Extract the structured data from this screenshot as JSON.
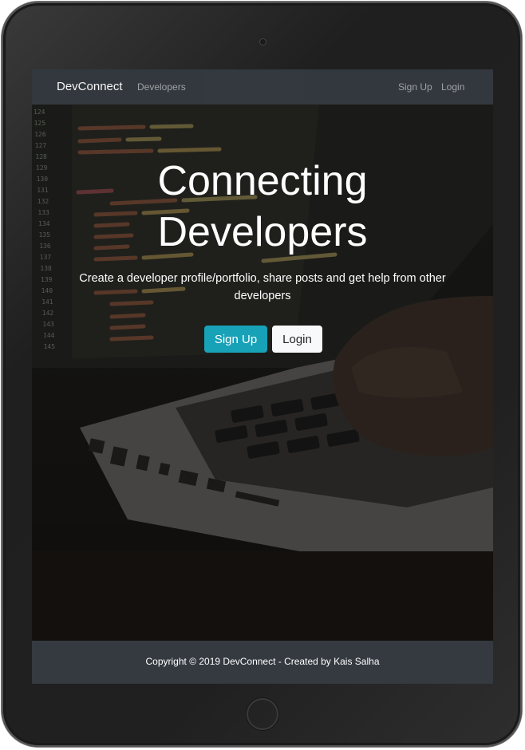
{
  "navbar": {
    "brand": "DevConnect",
    "developers_link": "Developers",
    "signup_link": "Sign Up",
    "login_link": "Login"
  },
  "hero": {
    "title_line1": "Connecting",
    "title_line2": "Developers",
    "lead": "Create a developer profile/portfolio, share posts and get help from other developers",
    "signup_button": "Sign Up",
    "login_button": "Login"
  },
  "footer": {
    "copyright": "Copyright © 2019 DevConnect - Created by Kais Salha"
  },
  "background_code": {
    "line_numbers": [
      "124",
      "125",
      "126",
      "127",
      "128",
      "129",
      "130",
      "131",
      "132",
      "133",
      "134",
      "135",
      "136",
      "137",
      "138",
      "139",
      "140",
      "141",
      "142",
      "143",
      "144",
      "145"
    ]
  },
  "colors": {
    "navbar": "#343a40",
    "info_button": "#17a2b8",
    "light_button": "#f8f9fa"
  }
}
